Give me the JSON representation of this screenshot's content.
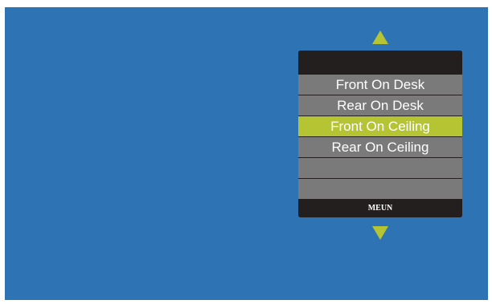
{
  "menu": {
    "items": [
      {
        "label": "Front On Desk",
        "selected": false
      },
      {
        "label": "Rear On Desk",
        "selected": false
      },
      {
        "label": "Front On Ceiling",
        "selected": true
      },
      {
        "label": "Rear On Ceiling",
        "selected": false
      },
      {
        "label": "",
        "selected": false
      },
      {
        "label": "",
        "selected": false
      }
    ],
    "footer_label": "MEUN"
  },
  "icons": {
    "up": "triangle-up-icon",
    "down": "triangle-down-icon"
  },
  "colors": {
    "background": "#2e74b5",
    "accent": "#b4c432",
    "item": "#7a7a7a",
    "panel": "#231f1e"
  }
}
